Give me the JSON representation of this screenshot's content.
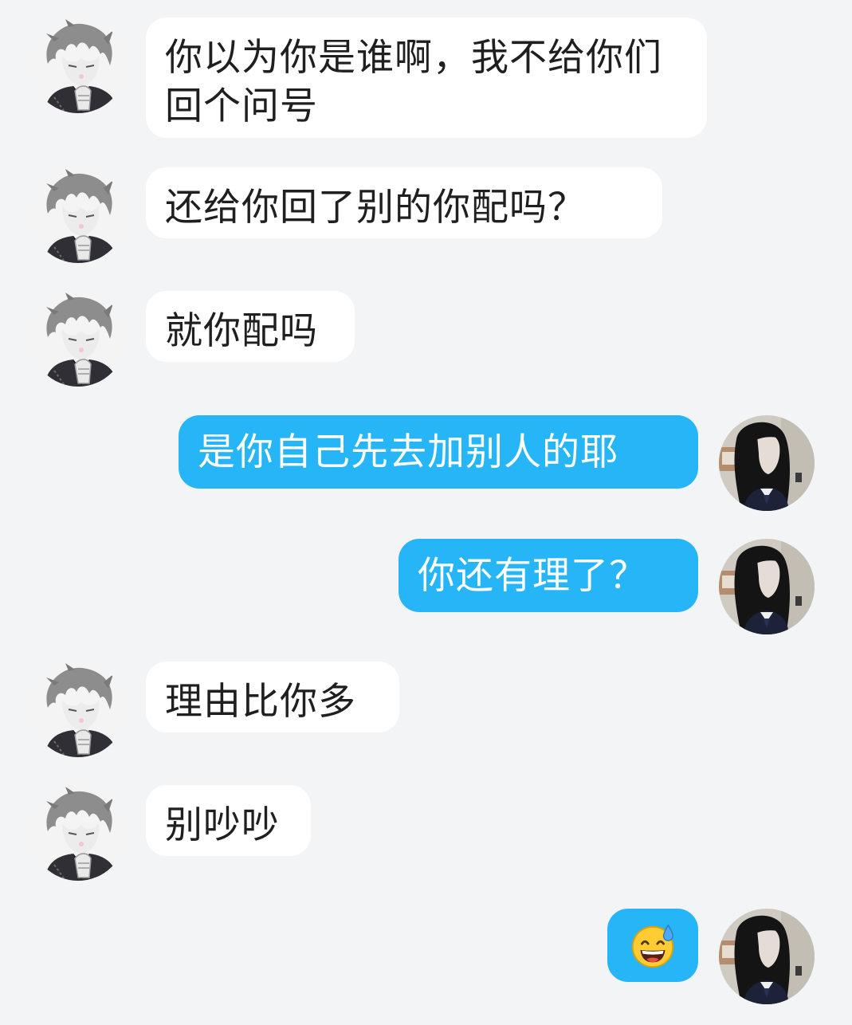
{
  "messages": [
    {
      "side": "in",
      "text": "你以为你是谁啊，我不给你们回个问号"
    },
    {
      "side": "in",
      "text": "还给你回了别的你配吗？"
    },
    {
      "side": "in",
      "text": "就你配吗"
    },
    {
      "side": "out",
      "text": "是你自己先去加别人的耶"
    },
    {
      "side": "out",
      "text": "你还有理了？"
    },
    {
      "side": "in",
      "text": "理由比你多"
    },
    {
      "side": "in",
      "text": "别吵吵"
    },
    {
      "side": "out",
      "emoji": "grinning-face-with-sweat"
    }
  ],
  "colors": {
    "background": "#f3f4f6",
    "incoming_bubble": "#ffffff",
    "outgoing_bubble": "#26b6f7",
    "incoming_text": "#1f1f1f",
    "outgoing_text": "#ffffff"
  },
  "avatars": {
    "incoming": "anime-boy-grey-hair-avatar",
    "outgoing": "girl-black-hair-avatar"
  }
}
